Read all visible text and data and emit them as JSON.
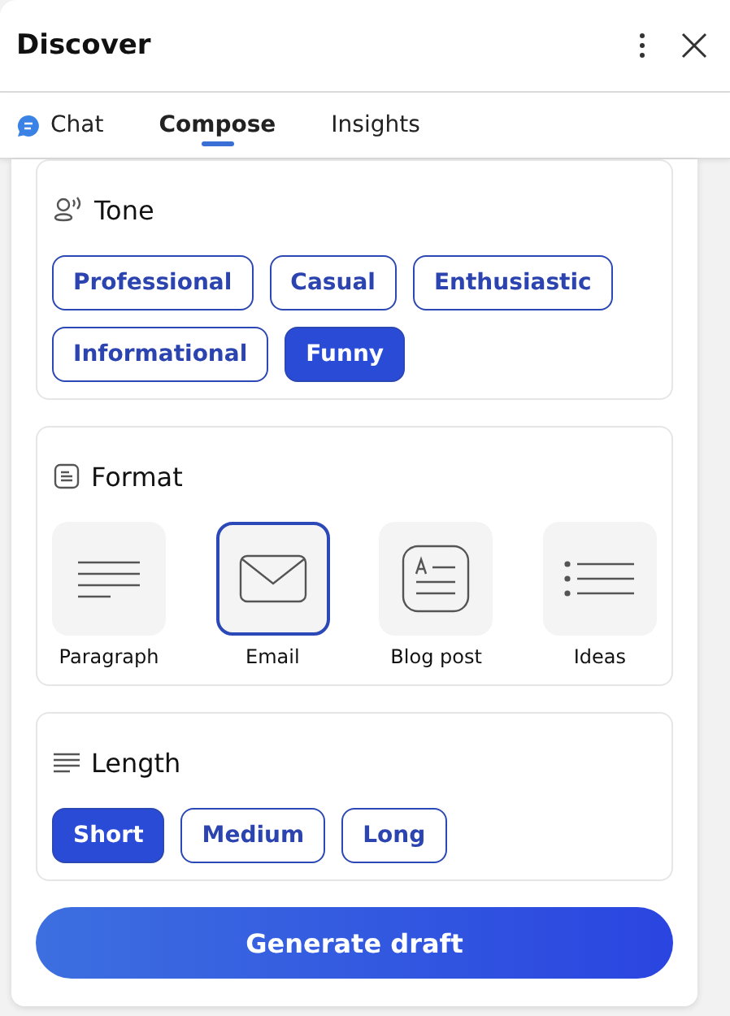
{
  "header": {
    "title": "Discover"
  },
  "tabs": [
    {
      "label": "Chat",
      "selected": false,
      "kind": "chat"
    },
    {
      "label": "Compose",
      "selected": true,
      "kind": "plain"
    },
    {
      "label": "Insights",
      "selected": false,
      "kind": "plain"
    }
  ],
  "sections": [
    {
      "title": "Tone",
      "kind": "chips",
      "options": [
        {
          "label": "Professional",
          "selected": false
        },
        {
          "label": "Casual",
          "selected": false
        },
        {
          "label": "Enthusiastic",
          "selected": false
        },
        {
          "label": "Informational",
          "selected": false
        },
        {
          "label": "Funny",
          "selected": true
        }
      ]
    },
    {
      "title": "Format",
      "kind": "tiles",
      "options": [
        {
          "label": "Paragraph",
          "selected": false,
          "kind": "paragraph"
        },
        {
          "label": "Email",
          "selected": true,
          "kind": "email"
        },
        {
          "label": "Blog post",
          "selected": false,
          "kind": "blog"
        },
        {
          "label": "Ideas",
          "selected": false,
          "kind": "ideas"
        }
      ]
    },
    {
      "title": "Length",
      "kind": "chips",
      "options": [
        {
          "label": "Short",
          "selected": true
        },
        {
          "label": "Medium",
          "selected": false
        },
        {
          "label": "Long",
          "selected": false
        }
      ]
    }
  ],
  "action": {
    "label": "Generate draft"
  }
}
